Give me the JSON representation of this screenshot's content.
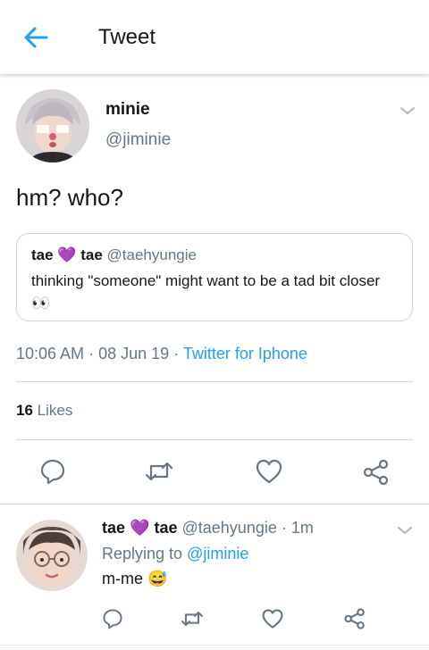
{
  "header": {
    "title": "Tweet"
  },
  "tweet": {
    "name": "minie",
    "handle": "@jiminie",
    "text": "hm? who?",
    "time": "10:06 AM",
    "dot1": "·",
    "date": "08 Jun 19",
    "dot2": "·",
    "source": "Twitter for Iphone",
    "likes_count": "16",
    "likes_label": "Likes"
  },
  "quote": {
    "name": "tae",
    "heart": "💜",
    "name2": "tae",
    "handle": "@taehyungie",
    "text": "thinking \"someone\" might want to be a tad bit closer",
    "emoji": "👀"
  },
  "reply": {
    "name": "tae",
    "heart": "💜",
    "name2": "tae",
    "handle": "@taehyungie",
    "dot": "·",
    "time": "1m",
    "replying_prefix": "Replying to",
    "replying_to": "@jiminie",
    "text": "m-me",
    "emoji": "😅"
  },
  "colors": {
    "accent": "#1da1f2",
    "secondary_text": "#657786",
    "border": "#ccd6dd",
    "icon": "#657786"
  }
}
